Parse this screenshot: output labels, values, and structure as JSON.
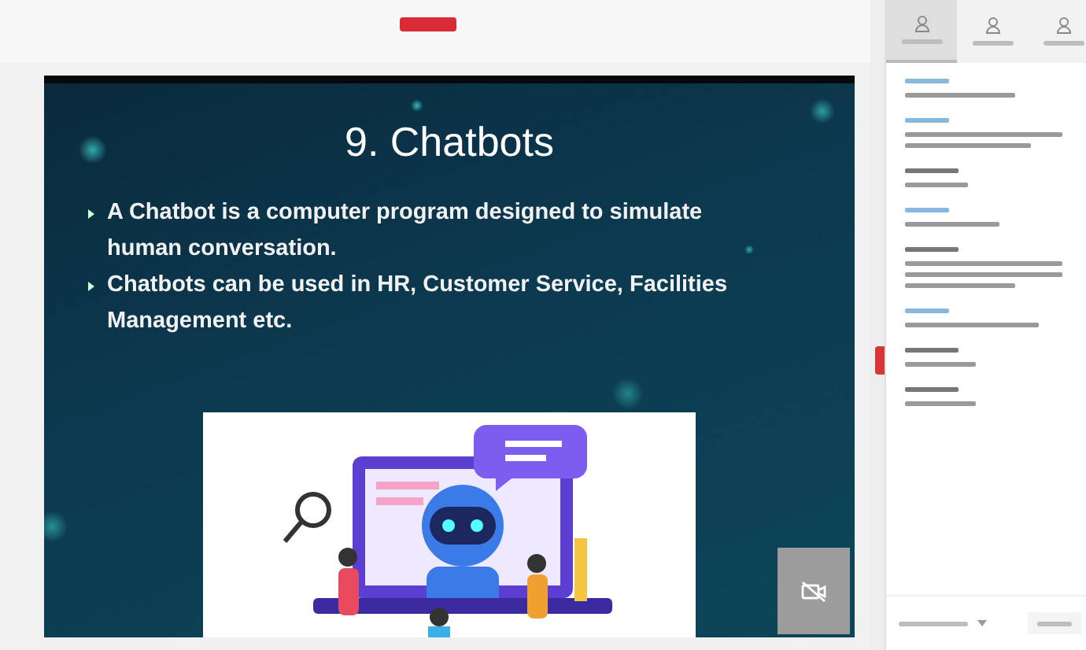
{
  "recording_badge": {
    "on": true
  },
  "slide": {
    "title": "9. Chatbots",
    "bullets": [
      "A Chatbot is a computer program designed to simulate human conversation.",
      "Chatbots can be used in HR, Customer Service, Facilities Management etc."
    ]
  },
  "camera_tile": {
    "video_on": false
  },
  "sidebar": {
    "tabs": [
      {
        "selected": true
      },
      {
        "selected": false
      },
      {
        "selected": false
      }
    ]
  }
}
